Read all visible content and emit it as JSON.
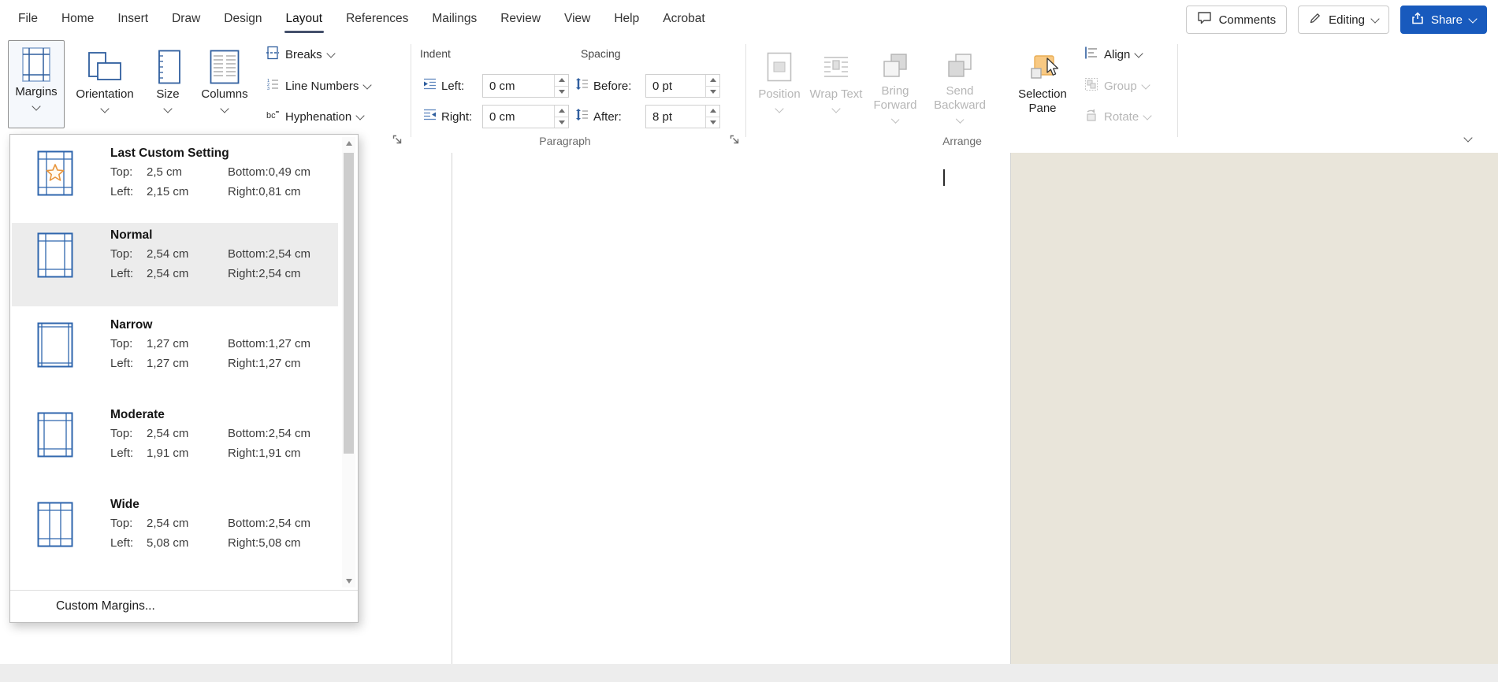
{
  "menubar": {
    "tabs": [
      {
        "label": "File"
      },
      {
        "label": "Home"
      },
      {
        "label": "Insert"
      },
      {
        "label": "Draw"
      },
      {
        "label": "Design"
      },
      {
        "label": "Layout"
      },
      {
        "label": "References"
      },
      {
        "label": "Mailings"
      },
      {
        "label": "Review"
      },
      {
        "label": "View"
      },
      {
        "label": "Help"
      },
      {
        "label": "Acrobat"
      }
    ],
    "active_tab": "Layout",
    "comments": "Comments",
    "editing": "Editing",
    "share": "Share"
  },
  "ribbon": {
    "page_setup": {
      "margins": "Margins",
      "orientation": "Orientation",
      "size": "Size",
      "columns": "Columns",
      "breaks": "Breaks",
      "line_numbers": "Line Numbers",
      "hyphenation": "Hyphenation"
    },
    "paragraph": {
      "caption": "Paragraph",
      "indent_heading": "Indent",
      "spacing_heading": "Spacing",
      "left_label": "Left:",
      "right_label": "Right:",
      "before_label": "Before:",
      "after_label": "After:",
      "left_value": "0 cm",
      "right_value": "0 cm",
      "before_value": "0 pt",
      "after_value": "8 pt"
    },
    "arrange": {
      "caption": "Arrange",
      "position": "Position",
      "wrap_text": "Wrap Text",
      "bring_forward": "Bring Forward",
      "send_backward": "Send Backward",
      "selection_pane": "Selection Pane",
      "align": "Align",
      "group": "Group",
      "rotate": "Rotate"
    }
  },
  "icon_glyphs": {
    "hyphenation": "bc",
    "ln1": "1",
    "ln2": "2",
    "ln3": "3"
  },
  "margins_menu": {
    "presets": [
      {
        "name": "Last Custom Setting",
        "top_label": "Top:",
        "top_value": "2,5 cm",
        "bottom_label": "Bottom:",
        "bottom_value": "0,49 cm",
        "left_label": "Left:",
        "left_value": "2,15 cm",
        "right_label": "Right:",
        "right_value": "0,81 cm"
      },
      {
        "name": "Normal",
        "top_label": "Top:",
        "top_value": "2,54 cm",
        "bottom_label": "Bottom:",
        "bottom_value": "2,54 cm",
        "left_label": "Left:",
        "left_value": "2,54 cm",
        "right_label": "Right:",
        "right_value": "2,54 cm"
      },
      {
        "name": "Narrow",
        "top_label": "Top:",
        "top_value": "1,27 cm",
        "bottom_label": "Bottom:",
        "bottom_value": "1,27 cm",
        "left_label": "Left:",
        "left_value": "1,27 cm",
        "right_label": "Right:",
        "right_value": "1,27 cm"
      },
      {
        "name": "Moderate",
        "top_label": "Top:",
        "top_value": "2,54 cm",
        "bottom_label": "Bottom:",
        "bottom_value": "2,54 cm",
        "left_label": "Left:",
        "left_value": "1,91 cm",
        "right_label": "Right:",
        "right_value": "1,91 cm"
      },
      {
        "name": "Wide",
        "top_label": "Top:",
        "top_value": "2,54 cm",
        "bottom_label": "Bottom:",
        "bottom_value": "2,54 cm",
        "left_label": "Left:",
        "left_value": "5,08 cm",
        "right_label": "Right:",
        "right_value": "5,08 cm"
      }
    ],
    "custom_margins": "Custom Margins..."
  }
}
